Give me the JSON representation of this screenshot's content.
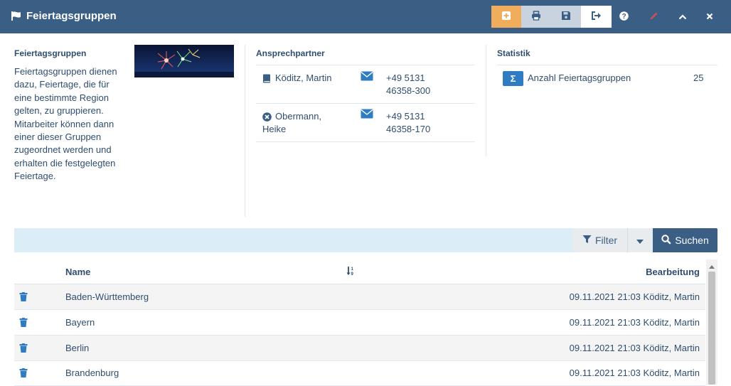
{
  "window": {
    "title": "Feiertagsgruppen",
    "icons": {
      "title": "flag-icon",
      "add": "plus-square-icon",
      "print": "print-icon",
      "save": "save-icon",
      "exit": "sign-out-icon",
      "help": "question-icon",
      "edit": "pencil-icon",
      "collapse": "chevron-up-icon",
      "close": "close-icon"
    },
    "colors": {
      "titlebar": "#3b5f84",
      "add_button": "#f0ad5c",
      "accent": "#2f7cc2"
    }
  },
  "info": {
    "heading": "Feiertagsgruppen",
    "description": "Feiertagsgruppen dienen dazu, Feiertage, die für eine bestimmte Region gelten, zu gruppieren. Mitarbeiter können dann einer dieser Gruppen zugeordnet werden und erhalten die festgelegten Feiertage.",
    "banner_icon": "fireworks-image"
  },
  "contacts": {
    "heading": "Ansprechpartner",
    "items": [
      {
        "status_icon": "book-icon",
        "name_line1": "Köditz, Martin",
        "name_line2": "",
        "mail_icon": "envelope-icon",
        "phone_line1": "+49 5131",
        "phone_line2": "46358-300"
      },
      {
        "status_icon": "times-circle-icon",
        "name_line1": "Obermann,",
        "name_line2": "Heike",
        "mail_icon": "envelope-icon",
        "phone_line1": "+49 5131",
        "phone_line2": "46358-170"
      }
    ]
  },
  "stats": {
    "heading": "Statistik",
    "badge": "Σ",
    "label": "Anzahl Feiertagsgruppen",
    "value": "25"
  },
  "search": {
    "filter_label": "Filter",
    "search_label": "Suchen",
    "icons": {
      "filter": "filter-icon",
      "dropdown": "caret-down-icon",
      "search": "search-icon"
    }
  },
  "table": {
    "columns": {
      "name": "Name",
      "edit": "Bearbeitung"
    },
    "sort_icon": "sort-numeric-icon",
    "delete_icon": "trash-icon",
    "rows": [
      {
        "name": "Baden-Württemberg",
        "edit": "09.11.2021 21:03 Köditz, Martin"
      },
      {
        "name": "Bayern",
        "edit": "09.11.2021 21:03 Köditz, Martin"
      },
      {
        "name": "Berlin",
        "edit": "09.11.2021 21:03 Köditz, Martin"
      },
      {
        "name": "Brandenburg",
        "edit": "09.11.2021 21:03 Köditz, Martin"
      }
    ]
  }
}
